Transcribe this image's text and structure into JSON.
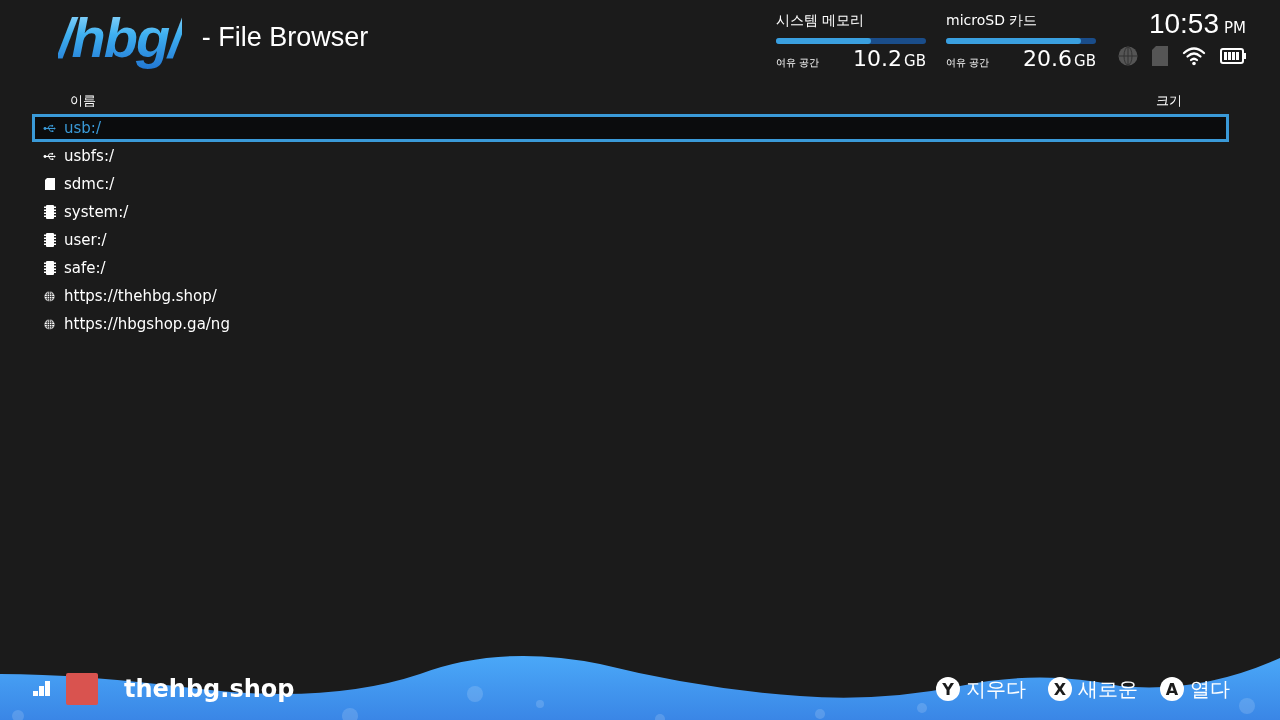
{
  "header": {
    "logo": "/hbg/",
    "title": "- File Browser",
    "storage": [
      {
        "name": "시스템 메모리",
        "level": 0.63,
        "caption": "여유 공간",
        "amount": "10.2",
        "unit": "GB"
      },
      {
        "name": "microSD 카드",
        "level": 0.9,
        "caption": "여유 공간",
        "amount": "20.6",
        "unit": "GB"
      }
    ],
    "clock": {
      "time": "10:53",
      "meridiem": "PM"
    }
  },
  "table": {
    "columns": [
      "이름",
      "크기"
    ],
    "rows": [
      {
        "kind": "usb",
        "name": "usb:/",
        "selected": true
      },
      {
        "kind": "usb",
        "name": "usbfs:/",
        "selected": false
      },
      {
        "kind": "sd",
        "name": "sdmc:/",
        "selected": false
      },
      {
        "kind": "chip",
        "name": "system:/",
        "selected": false
      },
      {
        "kind": "chip",
        "name": "user:/",
        "selected": false
      },
      {
        "kind": "chip",
        "name": "safe:/",
        "selected": false
      },
      {
        "kind": "globe",
        "name": "https://thehbg.shop/",
        "selected": false
      },
      {
        "kind": "globe",
        "name": "https://hbgshop.ga/ng",
        "selected": false
      }
    ]
  },
  "footer": {
    "user": "thehbg.shop",
    "actions": [
      {
        "key": "Y",
        "label": "지우다"
      },
      {
        "key": "X",
        "label": "새로운"
      },
      {
        "key": "A",
        "label": "열다"
      }
    ]
  }
}
